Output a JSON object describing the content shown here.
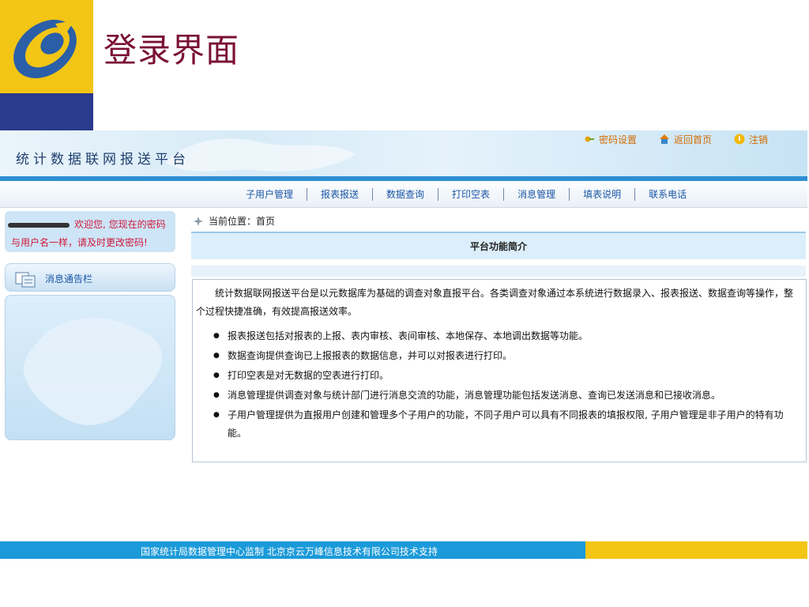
{
  "slide": {
    "title": "登录界面"
  },
  "header": {
    "brand": "统计数据联网报送平台",
    "links": [
      {
        "label": "密码设置",
        "icon": "key-icon"
      },
      {
        "label": "返回首页",
        "icon": "home-icon"
      },
      {
        "label": "注销",
        "icon": "logout-icon"
      }
    ]
  },
  "nav": {
    "items": [
      "子用户管理",
      "报表报送",
      "数据查询",
      "打印空表",
      "消息管理",
      "填表说明",
      "联系电话"
    ]
  },
  "sidebar": {
    "welcome_line1": "欢迎您, 您现在的密码",
    "welcome_line2": "与用户名一样，请及时更改密码!",
    "message_bar_label": "消息通告栏"
  },
  "main": {
    "breadcrumb": "当前位置：首页",
    "section_title": "平台功能简介",
    "intro": "统计数据联网报送平台是以元数据库为基础的调查对象直报平台。各类调查对象通过本系统进行数据录入、报表报送、数据查询等操作，整个过程快捷准确，有效提高报送效率。",
    "bullets": [
      "报表报送包括对报表的上报、表内审核、表间审核、本地保存、本地调出数据等功能。",
      "数据查询提供查询已上报报表的数据信息，并可以对报表进行打印。",
      "打印空表是对无数据的空表进行打印。",
      "消息管理提供调查对象与统计部门进行消息交流的功能，消息管理功能包括发送消息、查询已发送消息和已接收消息。",
      "子用户管理提供为直报用户创建和管理多个子用户的功能，不同子用户可以具有不同报表的填报权限, 子用户管理是非子用户的特有功能。"
    ]
  },
  "footer": {
    "text": "国家统计局数据管理中心监制 北京京云万峰信息技术有限公司技术支持"
  },
  "colors": {
    "title": "#7a1036",
    "nav_text": "#1a56a6",
    "warning_text": "#d0183c",
    "top_link": "#d36b00",
    "footer_blue": "#1b9ad9",
    "footer_yellow": "#f3c515"
  }
}
